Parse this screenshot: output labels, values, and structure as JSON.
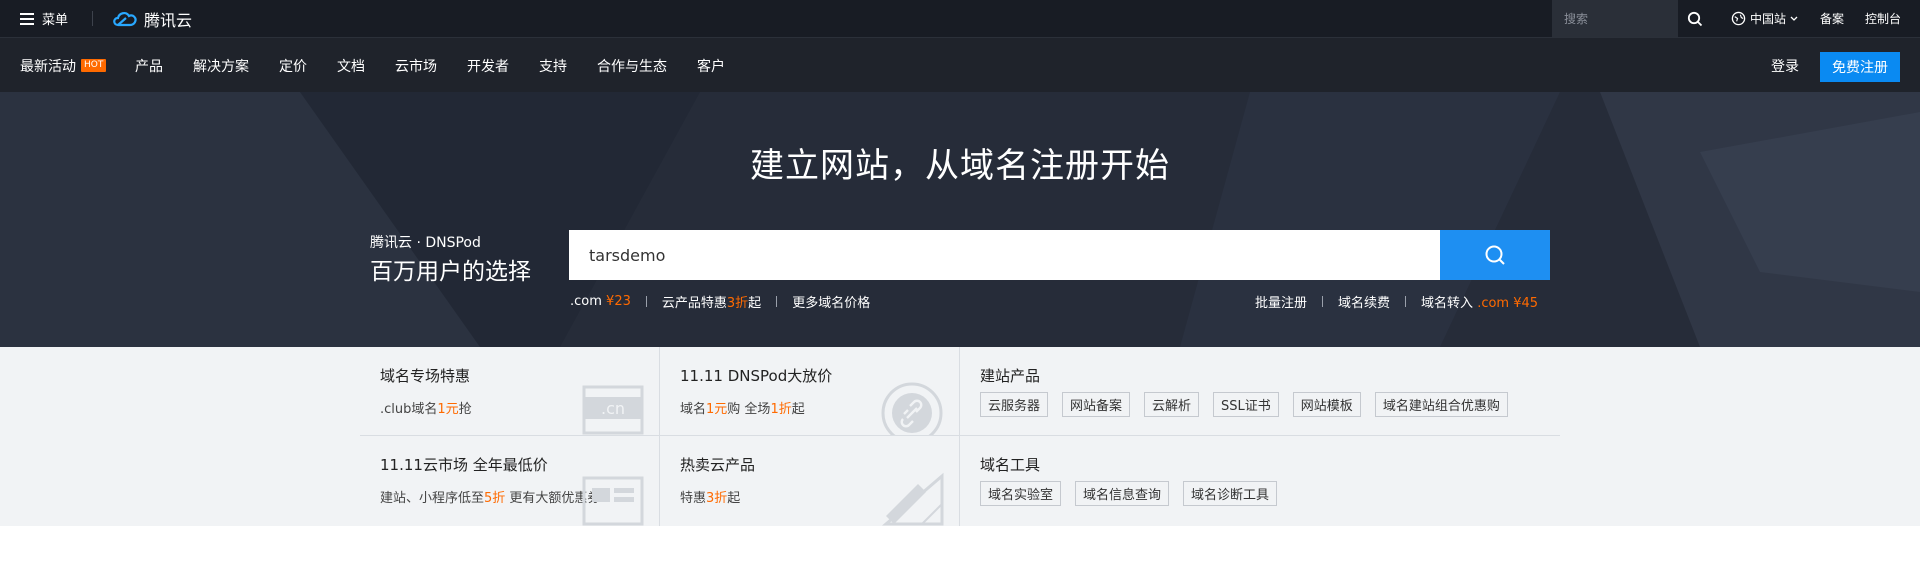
{
  "topbar": {
    "menu_label": "菜单",
    "logo_text": "腾讯云",
    "search_placeholder": "搜索",
    "region_label": "中国站",
    "beian_label": "备案",
    "console_label": "控制台"
  },
  "nav": {
    "items": [
      {
        "label": "最新活动",
        "badge": "HOT"
      },
      {
        "label": "产品"
      },
      {
        "label": "解决方案"
      },
      {
        "label": "定价"
      },
      {
        "label": "文档"
      },
      {
        "label": "云市场"
      },
      {
        "label": "开发者"
      },
      {
        "label": "支持"
      },
      {
        "label": "合作与生态"
      },
      {
        "label": "客户"
      }
    ],
    "login_label": "登录",
    "register_label": "免费注册"
  },
  "hero": {
    "title": "建立网站，从域名注册开始",
    "brand_small": "腾讯云 · DNSPod",
    "brand_big": "百万用户的选择",
    "search_value": "tarsdemo",
    "left_links": {
      "com_label": ".com",
      "com_price": "¥23",
      "promo_prefix": "云产品特惠",
      "promo_discount": "3折",
      "promo_suffix": "起",
      "more_prices": "更多域名价格"
    },
    "right_links": {
      "bulk": "批量注册",
      "renew": "域名续费",
      "transfer": "域名转入",
      "transfer_price": ".com ¥45"
    }
  },
  "promo": {
    "cells": {
      "domain_special": {
        "title": "域名专场特惠",
        "sub_prefix": ".club域名",
        "sub_highlight": "1元",
        "sub_suffix": "抢"
      },
      "double11_dnspod": {
        "title": "11.11 DNSPod大放价",
        "sub_a": "域名",
        "sub_a_highlight": "1元",
        "sub_b": "购 全场",
        "sub_b_highlight": "1折",
        "sub_c": "起"
      },
      "build_products": {
        "title": "建站产品",
        "tags": [
          "云服务器",
          "网站备案",
          "云解析",
          "SSL证书",
          "网站模板",
          "域名建站组合优惠购"
        ]
      },
      "double11_market": {
        "title": "11.11云市场 全年最低价",
        "sub_prefix": "建站、小程序低至",
        "sub_highlight": "5折",
        "sub_suffix": " 更有大额优惠券"
      },
      "hot_products": {
        "title": "热卖云产品",
        "sub_prefix": "特惠",
        "sub_highlight": "3折",
        "sub_suffix": "起"
      },
      "domain_tools": {
        "title": "域名工具",
        "tags": [
          "域名实验室",
          "域名信息查询",
          "域名诊断工具"
        ]
      }
    }
  },
  "colors": {
    "accent_blue": "#1e8ff2",
    "highlight_orange": "#ff6a00",
    "topbar_bg": "#181c24",
    "hero_bg": "#262c39"
  }
}
